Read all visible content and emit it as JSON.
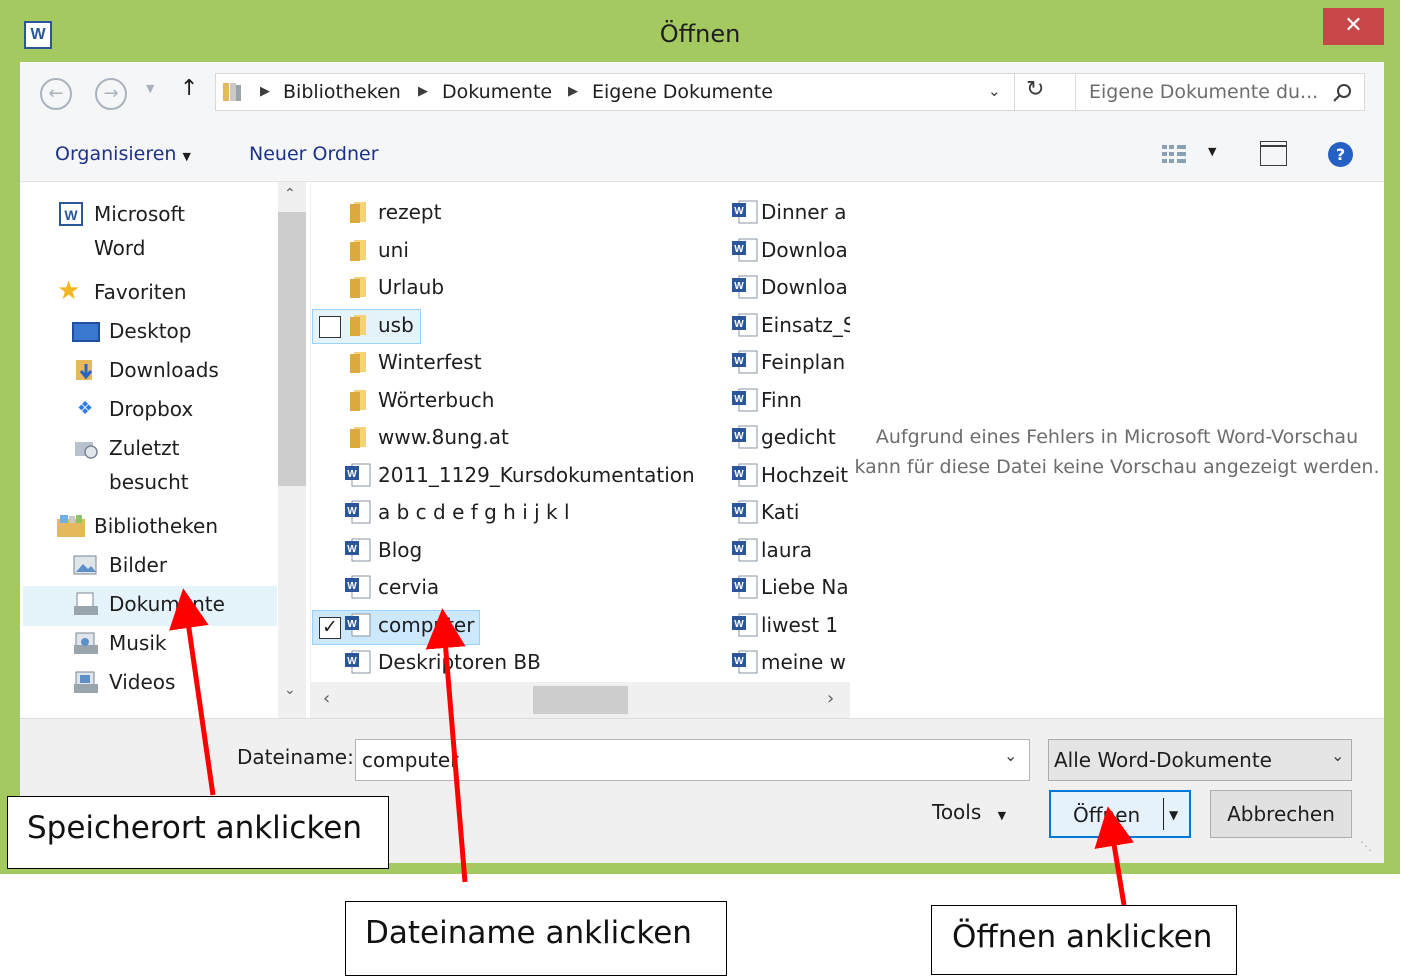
{
  "window": {
    "title": "Öffnen",
    "app_icon_letter": "W",
    "close_glyph": "✕"
  },
  "address_bar": {
    "crumbs": [
      "Bibliotheken",
      "Dokumente",
      "Eigene Dokumente"
    ],
    "search_placeholder": "Eigene Dokumente du..."
  },
  "toolbar": {
    "organize": "Organisieren",
    "new_folder": "Neuer Ordner"
  },
  "sidebar": {
    "items": [
      {
        "label": "Microsoft Word",
        "icon": "word-icon"
      },
      {
        "label": "Favoriten",
        "icon": "star-icon"
      },
      {
        "label": "Desktop",
        "icon": "desktop-icon"
      },
      {
        "label": "Downloads",
        "icon": "downloads-icon"
      },
      {
        "label": "Dropbox",
        "icon": "dropbox-icon"
      },
      {
        "label": "Zuletzt besucht",
        "icon": "recent-places-icon"
      },
      {
        "label": "Bibliotheken",
        "icon": "libraries-icon"
      },
      {
        "label": "Bilder",
        "icon": "pictures-icon"
      },
      {
        "label": "Dokumente",
        "icon": "documents-icon"
      },
      {
        "label": "Musik",
        "icon": "music-icon"
      },
      {
        "label": "Videos",
        "icon": "videos-icon"
      }
    ],
    "selected": "Dokumente"
  },
  "files": {
    "column1": [
      {
        "name": "rezept",
        "type": "folder"
      },
      {
        "name": "uni",
        "type": "folder"
      },
      {
        "name": "Urlaub",
        "type": "folder"
      },
      {
        "name": "usb",
        "type": "folder"
      },
      {
        "name": "Winterfest",
        "type": "folder"
      },
      {
        "name": "Wörterbuch",
        "type": "folder"
      },
      {
        "name": "www.8ung.at",
        "type": "folder"
      },
      {
        "name": "2011_1129_Kursdokumentation",
        "type": "document"
      },
      {
        "name": "a b c d e f g h i j k l",
        "type": "document"
      },
      {
        "name": "Blog",
        "type": "document"
      },
      {
        "name": "cervia",
        "type": "document"
      },
      {
        "name": "computer",
        "type": "document"
      },
      {
        "name": "Deskriptoren BB",
        "type": "document"
      }
    ],
    "column2": [
      {
        "name": "Dinner a",
        "type": "document"
      },
      {
        "name": "Downloa",
        "type": "document"
      },
      {
        "name": "Downloa",
        "type": "document"
      },
      {
        "name": "Einsatz_S",
        "type": "document"
      },
      {
        "name": "Feinplan",
        "type": "document"
      },
      {
        "name": "Finn",
        "type": "document"
      },
      {
        "name": "gedicht",
        "type": "document"
      },
      {
        "name": "Hochzeit",
        "type": "document"
      },
      {
        "name": "Kati",
        "type": "document"
      },
      {
        "name": "laura",
        "type": "document"
      },
      {
        "name": "Liebe Na",
        "type": "document"
      },
      {
        "name": "liwest 1",
        "type": "document"
      },
      {
        "name": "meine w",
        "type": "document"
      }
    ],
    "selected": "computer",
    "hovered": "usb"
  },
  "preview": {
    "message_line1": "Aufgrund eines Fehlers in Microsoft Word-Vorschau",
    "message_line2": "kann für diese Datei keine Vorschau angezeigt werden."
  },
  "bottom": {
    "filename_label": "Dateiname:",
    "filename_value": "computer",
    "filter_value": "Alle Word-Dokumente",
    "tools": "Tools",
    "open": "Öffnen",
    "cancel": "Abbrechen"
  },
  "annotations": {
    "location": "Speicherort anklicken",
    "filename": "Dateiname anklicken",
    "open": "Öffnen anklicken",
    "arrow_color": "#ff0000"
  }
}
